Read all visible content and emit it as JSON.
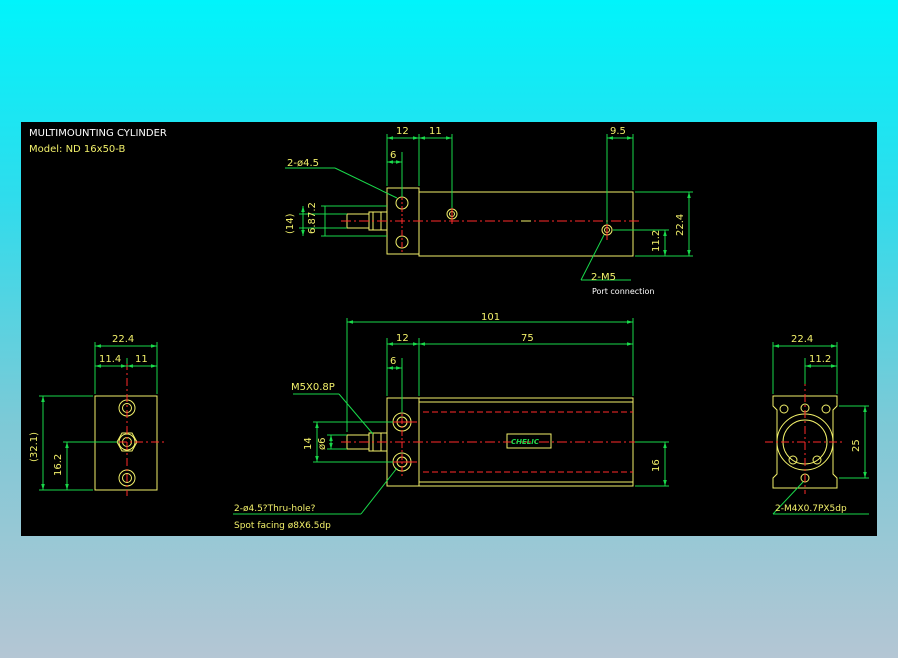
{
  "title": "MULTIMOUNTING CYLINDER",
  "model": "Model: ND 16x50-B",
  "colors": {
    "background": "#000000",
    "outline": "#f2f06a",
    "dimension": "#19d84a",
    "centerline": "#ff2a2a",
    "text": "#ffffff",
    "page_gradient_top": "#00f4fb",
    "page_gradient_bottom": "#b4c6d4"
  },
  "top_view": {
    "dims": {
      "d12": "12",
      "d11": "11",
      "d9_5": "9.5",
      "d6": "6",
      "d14": "(14)",
      "d6_8": "6.8",
      "d7_2": "7.2",
      "d11_2": "11.2",
      "d22_4": "22.4"
    },
    "hole_callout": "2-ø4.5",
    "port_callout": "2-M5",
    "port_note": "Port connection"
  },
  "left_view": {
    "dims": {
      "width": "22.4",
      "half_left": "11.4",
      "half_right": "11",
      "height": "(32.1)",
      "center_height": "16.2"
    }
  },
  "front_view": {
    "dims": {
      "overall": "101",
      "d12": "12",
      "d75": "75",
      "d6": "6",
      "d14": "14",
      "d6_small": "ø6",
      "d16": "16"
    },
    "thread_callout": "M5X0.8P",
    "hole_callout": "2-ø4.5?Thru-hole?",
    "spot_facing": "Spot facing  ø8X6.5dp",
    "nameplate": "CHELIC"
  },
  "right_view": {
    "dims": {
      "width": "22.4",
      "half": "11.2",
      "height": "25"
    },
    "thread_callout": "2-M4X0.7PX5dp"
  }
}
